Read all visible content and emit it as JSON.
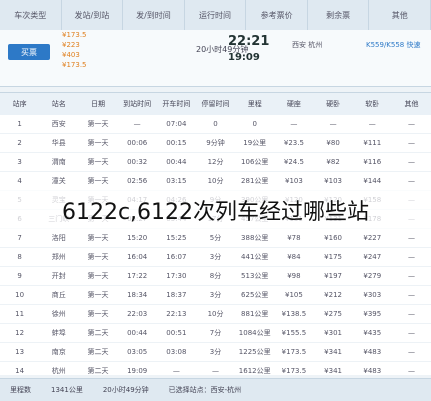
{
  "header": {
    "cols": [
      "车次类型",
      "发站/到站",
      "发/到时间",
      "运行时间",
      "参考票价",
      "剩余票",
      "其他"
    ]
  },
  "summary": {
    "button": "买票",
    "prices": [
      "¥173.5",
      "¥223",
      "¥403",
      "¥173.5"
    ],
    "runtime": "20小时49分钟",
    "depart_time": "22:21",
    "arrive_time": "19:09",
    "stations": "西安 杭州",
    "train": "K559/K558 快速"
  },
  "table": {
    "headers": [
      "站序",
      "站名",
      "日期",
      "到站时间",
      "开车时间",
      "停留时间",
      "里程",
      "硬座",
      "硬卧",
      "软卧",
      "其他"
    ],
    "rows": [
      [
        "1",
        "西安",
        "第一天",
        "—",
        "07:04",
        "0",
        "0",
        "—",
        "—",
        "—",
        "—"
      ],
      [
        "2",
        "华县",
        "第一天",
        "00:06",
        "00:15",
        "9分钟",
        "19公里",
        "¥23.5",
        "¥80",
        "¥111",
        "—"
      ],
      [
        "3",
        "渭南",
        "第一天",
        "00:32",
        "00:44",
        "12分",
        "106公里",
        "¥24.5",
        "¥82",
        "¥116",
        "—"
      ],
      [
        "4",
        "潼关",
        "第一天",
        "02:56",
        "03:15",
        "10分",
        "281公里",
        "¥103",
        "¥103",
        "¥144",
        "—"
      ],
      [
        "5",
        "灵宝",
        "第一天",
        "04:17",
        "04:26",
        "9分",
        "390公里",
        "¥120",
        "¥120",
        "¥158",
        "—"
      ],
      [
        "6",
        "三门峡",
        "第一天",
        "05:27",
        "05:44",
        "17分",
        "457公里",
        "¥131",
        "¥131",
        "¥178",
        "—"
      ],
      [
        "7",
        "洛阳",
        "第一天",
        "15:20",
        "15:25",
        "5分",
        "388公里",
        "¥78",
        "¥160",
        "¥227",
        "—"
      ],
      [
        "8",
        "郑州",
        "第一天",
        "16:04",
        "16:07",
        "3分",
        "441公里",
        "¥84",
        "¥175",
        "¥247",
        "—"
      ],
      [
        "9",
        "开封",
        "第一天",
        "17:22",
        "17:30",
        "8分",
        "513公里",
        "¥98",
        "¥197",
        "¥279",
        "—"
      ],
      [
        "10",
        "商丘",
        "第一天",
        "18:34",
        "18:37",
        "3分",
        "625公里",
        "¥105",
        "¥212",
        "¥303",
        "—"
      ],
      [
        "11",
        "徐州",
        "第一天",
        "22:03",
        "22:13",
        "10分",
        "881公里",
        "¥138.5",
        "¥275",
        "¥395",
        "—"
      ],
      [
        "12",
        "蚌埠",
        "第二天",
        "00:44",
        "00:51",
        "7分",
        "1084公里",
        "¥155.5",
        "¥301",
        "¥435",
        "—"
      ],
      [
        "13",
        "南京",
        "第二天",
        "03:05",
        "03:08",
        "3分",
        "1225公里",
        "¥173.5",
        "¥341",
        "¥483",
        "—"
      ],
      [
        "14",
        "杭州",
        "第二天",
        "19:09",
        "—",
        "—",
        "1612公里",
        "¥173.5",
        "¥341",
        "¥483",
        "—"
      ]
    ]
  },
  "overlay": {
    "text": "6122c,6122次列车经过哪些站"
  },
  "footer": {
    "left": "里程数",
    "mid": "1341公里",
    "time": "20小时49分钟",
    "note": "已选择站点：西安-杭州"
  }
}
